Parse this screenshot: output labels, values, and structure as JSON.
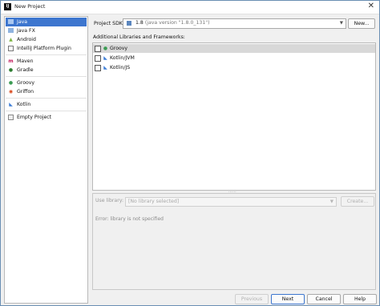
{
  "window": {
    "title": "New Project",
    "app_icon": "IJ"
  },
  "sidebar": {
    "items": [
      {
        "label": "Java",
        "icon": "java-folder-icon",
        "selected": true
      },
      {
        "label": "Java FX",
        "icon": "javafx-icon"
      },
      {
        "label": "Android",
        "icon": "android-icon"
      },
      {
        "label": "IntelliJ Platform Plugin",
        "icon": "plugin-icon"
      },
      {
        "label": "Maven",
        "icon": "maven-icon"
      },
      {
        "label": "Gradle",
        "icon": "gradle-icon"
      },
      {
        "label": "Groovy",
        "icon": "groovy-icon"
      },
      {
        "label": "Griffon",
        "icon": "griffon-icon"
      },
      {
        "label": "Kotlin",
        "icon": "kotlin-icon"
      },
      {
        "label": "Empty Project",
        "icon": "empty-project-icon"
      }
    ]
  },
  "sdk": {
    "label": "Project SDK:",
    "value": "1.8",
    "version": "(java version \"1.8.0_131\")",
    "new_button": "New..."
  },
  "libraries": {
    "label": "Additional Libraries and Frameworks:",
    "items": [
      {
        "label": "Groovy",
        "icon": "groovy-icon",
        "checked": false,
        "selected": true
      },
      {
        "label": "Kotlin/JVM",
        "icon": "kotlin-icon",
        "checked": false
      },
      {
        "label": "Kotlin/JS",
        "icon": "kotlin-icon",
        "checked": false
      }
    ]
  },
  "details": {
    "use_library_label": "Use library:",
    "use_library_value": "[No library selected]",
    "create_button": "Create...",
    "error": "Error: library is not specified"
  },
  "footer": {
    "previous": "Previous",
    "next": "Next",
    "cancel": "Cancel",
    "help": "Help"
  },
  "colors": {
    "selection": "#3d76cf",
    "frame": "#6a8fb3"
  }
}
